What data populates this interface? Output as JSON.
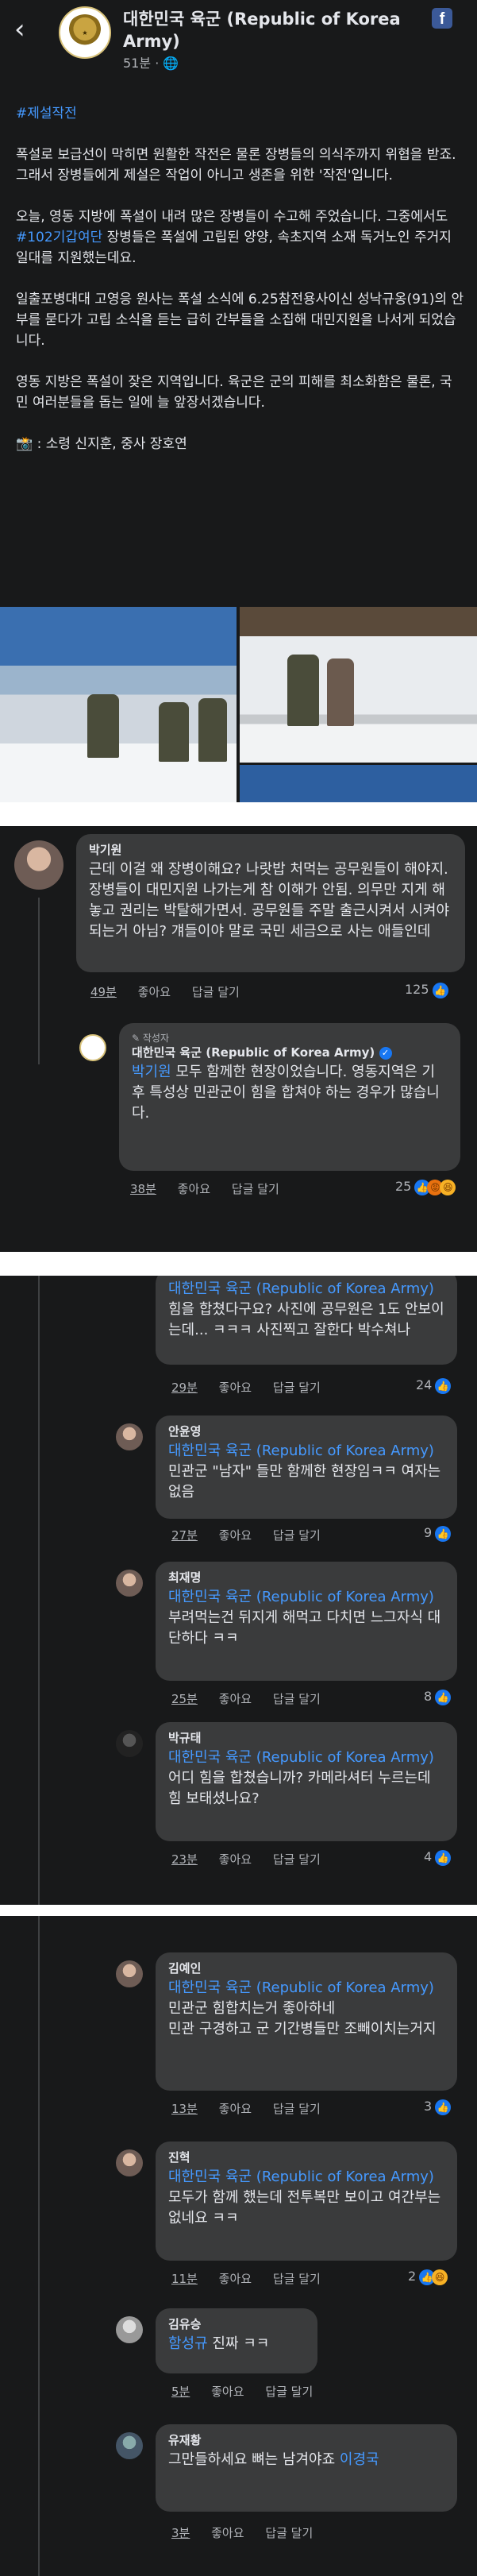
{
  "post": {
    "page_name": "대한민국 육군 (Republic of Korea Army)",
    "time": "51분",
    "privacy_icon": "globe-icon",
    "hashtag": "#제설작전",
    "p1": "폭설로 보급선이 막히면 원활한 작전은 물론 장병들의 의식주까지 위협을 받죠. 그래서 장병들에게 제설은 작업이 아니고 생존을 위한 '작전'입니다.",
    "p2a": "오늘, 영동 지방에 폭설이 내려 많은 장병들이 수고해 주었습니다. 그중에서도 ",
    "p2_tag": "#102기갑여단",
    "p2b": " 장병들은 폭설에 고립된 양양, 속초지역 소재 독거노인 주거지 일대를 지원했는데요.",
    "p3": "일출포병대대 고영응 원사는 폭설 소식에 6.25참전용사이신 성낙규옹(91)의 안부를 묻다가 고립 소식을 듣는 급히 간부들을 소집해 대민지원을 나서게 되었습니다.",
    "p4": "영동 지방은 폭설이 잦은 지역입니다. 육군은 군의 피해를 최소화함은 물론, 국민 여러분들을 돕는 일에 늘 앞장서겠습니다.",
    "credit": "📸 : 소령 신지훈, 중사 장호연"
  },
  "comments": [
    {
      "name": "박기원",
      "text": "근데 이걸 왜 장병이해요? 나랏밥 처먹는 공무원들이 해야지. 장병들이 대민지원 나가는게 참 이해가 안됨. 의무만 지게 해놓고 권리는 박탈해가면서. 공무원들 주말 출근시켜서 시켜야 되는거 아님? 걔들이야 말로 국민 세금으로 사는 애들인데",
      "time": "49분",
      "like": "좋아요",
      "reply": "답글 달기",
      "count": "125"
    },
    {
      "badge": "작성자",
      "name": "대한민국 육군 (Republic of Korea Army)",
      "mention": "박기원",
      "text": " 모두 함께한 현장이었습니다. 영동지역은 기후 특성상 민관군이 힘을 합쳐야 하는 경우가 많습니다.",
      "time": "38분",
      "like": "좋아요",
      "reply": "답글 달기",
      "count": "25"
    },
    {
      "mention": "대한민국 육군 (Republic of Korea Army)",
      "text": " 힘을 합쳤다구요? 사진에 공무원은 1도 안보이는데... ㅋㅋㅋ 사진찍고 잘한다 박수쳐나",
      "time": "29분",
      "like": "좋아요",
      "reply": "답글 달기",
      "count": "24"
    },
    {
      "name": "안윤영",
      "mention": "대한민국 육군 (Republic of Korea Army)",
      "text": " 민관군 \"남자\" 들만 함께한 현장임ㅋㅋ 여자는 없음",
      "time": "27분",
      "like": "좋아요",
      "reply": "답글 달기",
      "count": "9"
    },
    {
      "name": "최재명",
      "mention": "대한민국 육군 (Republic of Korea Army)",
      "text": " 부려먹는건 뒤지게 해먹고 다치면 느그자식 대단하다 ㅋㅋ",
      "time": "25분",
      "like": "좋아요",
      "reply": "답글 달기",
      "count": "8"
    },
    {
      "name": "박규태",
      "mention": "대한민국 육군 (Republic of Korea Army)",
      "text": " 어디 힘을 합쳤습니까? 카메라셔터 누르는데 힘 보태셨나요?",
      "time": "23분",
      "like": "좋아요",
      "reply": "답글 달기",
      "count": "4"
    },
    {
      "name": "김예인",
      "mention": "대한민국 육군 (Republic of Korea Army)",
      "text": " 민관군 힘합치는거 좋아하네\n민관 구경하고 군 기간병들만 조빼이치는거지",
      "time": "13분",
      "like": "좋아요",
      "reply": "답글 달기",
      "count": "3"
    },
    {
      "name": "진혁",
      "mention": "대한민국 육군 (Republic of Korea Army)",
      "text": "  모두가 함께 했는데 전투복만 보이고 여간부는 없네요 ㅋㅋ",
      "time": "11분",
      "like": "좋아요",
      "reply": "답글 달기",
      "count": "2"
    },
    {
      "name": "김유승",
      "mention": "함성규",
      "text": " 진짜 ㅋㅋ",
      "time": "5분",
      "like": "좋아요",
      "reply": "답글 달기"
    },
    {
      "name": "유재황",
      "text": "그만들하세요 뼈는 남겨야죠 ",
      "mention": "이경국",
      "time": "3분",
      "like": "좋아요",
      "reply": "답글 달기"
    }
  ],
  "colors": {
    "bg": "#18191a",
    "bubble": "#3a3b3c",
    "link": "#4599ff",
    "like": "#1877f2"
  }
}
